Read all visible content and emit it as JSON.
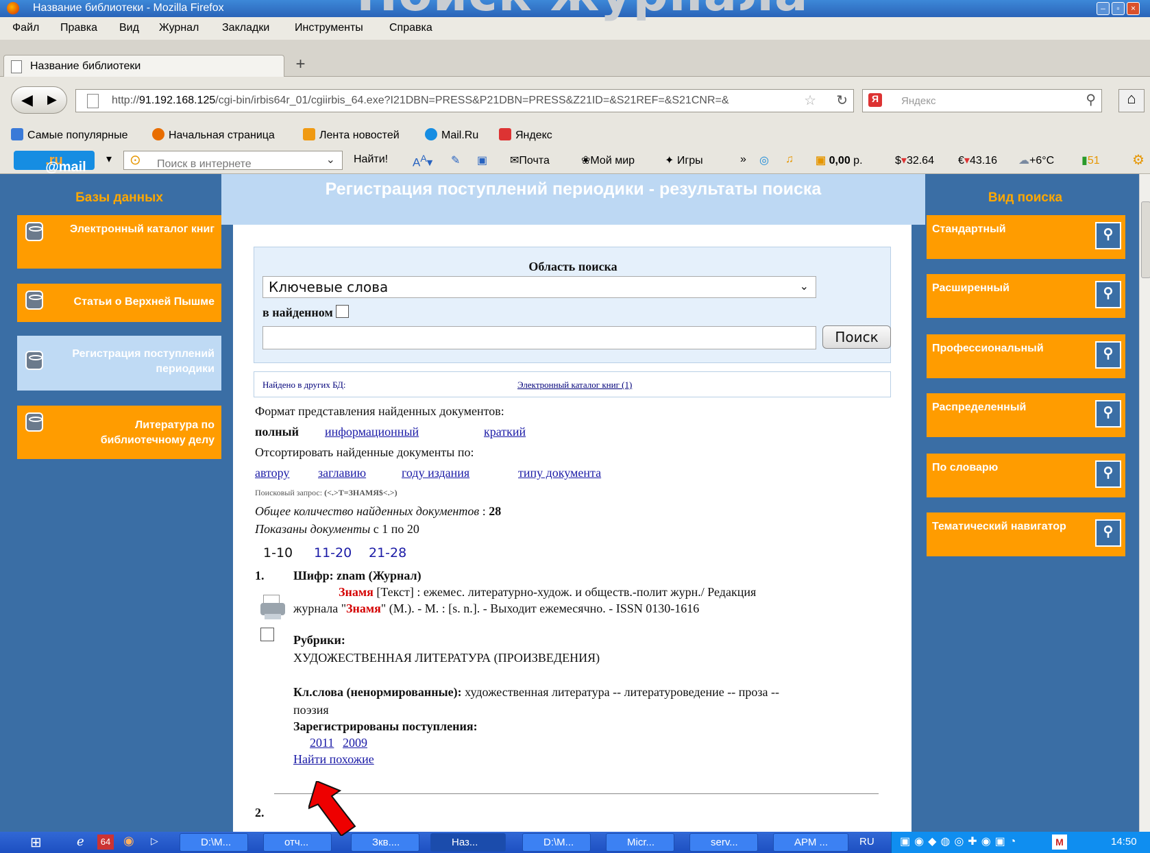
{
  "slide_title": "Поиск журнала",
  "window": {
    "title": "Название библиотеки - Mozilla Firefox"
  },
  "menu": [
    "Файл",
    "Правка",
    "Вид",
    "Журнал",
    "Закладки",
    "Инструменты",
    "Справка"
  ],
  "tab": {
    "label": "Название библиотеки",
    "new_tab": "+"
  },
  "nav": {
    "url_prefix": "http://",
    "url_host": "91.192.168.125",
    "url_rest": "/cgi-bin/irbis64r_01/cgiirbis_64.exe?I21DBN=PRESS&P21DBN=PRESS&Z21ID=&S21REF=&S21CNR=&",
    "search_placeholder": "Яндекс"
  },
  "bookmarks": [
    "Самые популярные",
    "Начальная страница",
    "Лента новостей",
    "Mail.Ru",
    "Яндекс"
  ],
  "mailbar": {
    "logo_a": "@mail",
    "logo_b": ".ru",
    "search_placeholder": "Поиск в интернете",
    "find": "Найти!",
    "mail": "Почта",
    "my_world": "Мой мир",
    "games": "Игры",
    "balance": "0,00",
    "balance_unit": "р.",
    "usd": "32.64",
    "eur": "43.16",
    "temp": "+6°C",
    "counter": "51"
  },
  "left": {
    "heading": "Базы данных",
    "items": [
      "Электронный каталог книг",
      "Статьи о Верхней Пышме",
      "Регистрация поступлений периодики",
      "Литература по библиотечному делу"
    ]
  },
  "center": {
    "heading": "Регистрация поступлений периодики - результаты поиска",
    "search_area_title": "Область поиска",
    "search_select": "Ключевые слова",
    "in_found": "в найденном",
    "search_button": "Поиск",
    "found_other_label": "Найдено в других БД:",
    "found_other_link": "Электронный каталог книг (1)",
    "format_label": "Формат представления найденных документов:",
    "format_current": "полный",
    "format_info": "информационный",
    "format_short": "краткий",
    "sort_label": "Отсортировать найденные документы по:",
    "sort": [
      "автору",
      "заглавию",
      "году издания",
      "типу документа"
    ],
    "query_label": "Поисковый запрос:",
    "query_value": "(<.>T=ЗНАМЯ$<.>)",
    "total_label": "Общее количество найденных документов",
    "total_value": "28",
    "shown_label": "Показаны документы",
    "shown_range": "с 1 по 20",
    "pages": [
      "1-10",
      "11-20",
      "21-28"
    ],
    "record": {
      "num": "1.",
      "cipher": "Шифр: znam (Журнал)",
      "title_word": "Знамя",
      "desc_a": " [Текст] : ежемес. литературно-худож. и обществ.-полит журн./ Редакция",
      "desc_b_pre": "журнала \"",
      "desc_b_mid": "Знамя",
      "desc_b_post": "\" (М.). - М. : [s. n.]. - Выходит ежемесячно. - ISSN 0130-1616",
      "rubrics_label": "Рубрики:",
      "rubric": "ХУДОЖЕСТВЕННАЯ ЛИТЕРАТУРА (ПРОИЗВЕДЕНИЯ)",
      "kw_label": "Кл.слова (ненормированные):",
      "kw_a": " художественная литература -- литературоведение -- проза --",
      "kw_b": "поэзия",
      "reg_label": "Зарегистрированы поступления:",
      "years": [
        "2011",
        "2009"
      ],
      "similar": "Найти похожие"
    },
    "next_num": "2."
  },
  "right": {
    "heading": "Вид поиска",
    "items": [
      "Стандартный",
      "Расширенный",
      "Профессиональный",
      "Распределенный",
      "По словарю",
      "Тематический навигатор"
    ]
  },
  "taskbar": {
    "items": [
      "D:\\M...",
      "отч...",
      "Зкв....",
      "Наз...",
      "D:\\M...",
      "Micr...",
      "serv...",
      "АРМ ..."
    ],
    "lang": "RU",
    "clock": "14:50"
  },
  "colors": {
    "accent_orange": "#ff9c00",
    "page_blue": "#3a6ea5",
    "heading_light": "#bdd8f3",
    "highlight_red": "#d40000"
  }
}
